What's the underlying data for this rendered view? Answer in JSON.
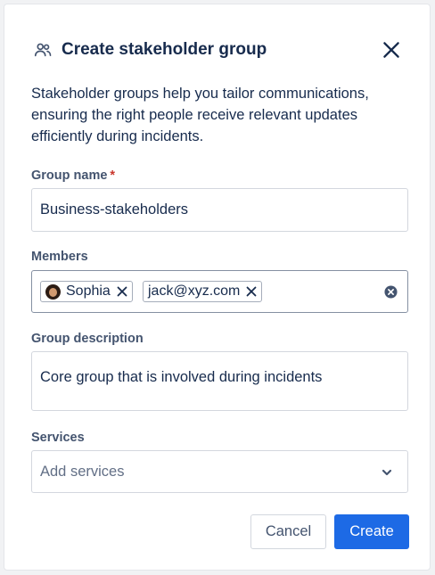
{
  "dialog": {
    "title": "Create stakeholder group",
    "description": "Stakeholder groups help you tailor communications, ensuring the right people receive relevant updates efficiently during incidents."
  },
  "group_name": {
    "label": "Group name",
    "required_marker": "*",
    "value": "Business-stakeholders"
  },
  "members": {
    "label": "Members",
    "tags": [
      {
        "label": "Sophia",
        "has_avatar": true
      },
      {
        "label": "jack@xyz.com",
        "has_avatar": false
      }
    ]
  },
  "group_description": {
    "label": "Group description",
    "value": "Core group that is involved during incidents"
  },
  "services": {
    "label": "Services",
    "placeholder": "Add services"
  },
  "actions": {
    "cancel_label": "Cancel",
    "create_label": "Create"
  },
  "colors": {
    "primary": "#1d6ae5",
    "required": "#c9372c",
    "text": "#172b4d",
    "subtle_text": "#44546f"
  },
  "icons": {
    "header": "people-icon",
    "close": "close-icon",
    "clear": "clear-icon",
    "dropdown": "chevron-down-icon"
  }
}
